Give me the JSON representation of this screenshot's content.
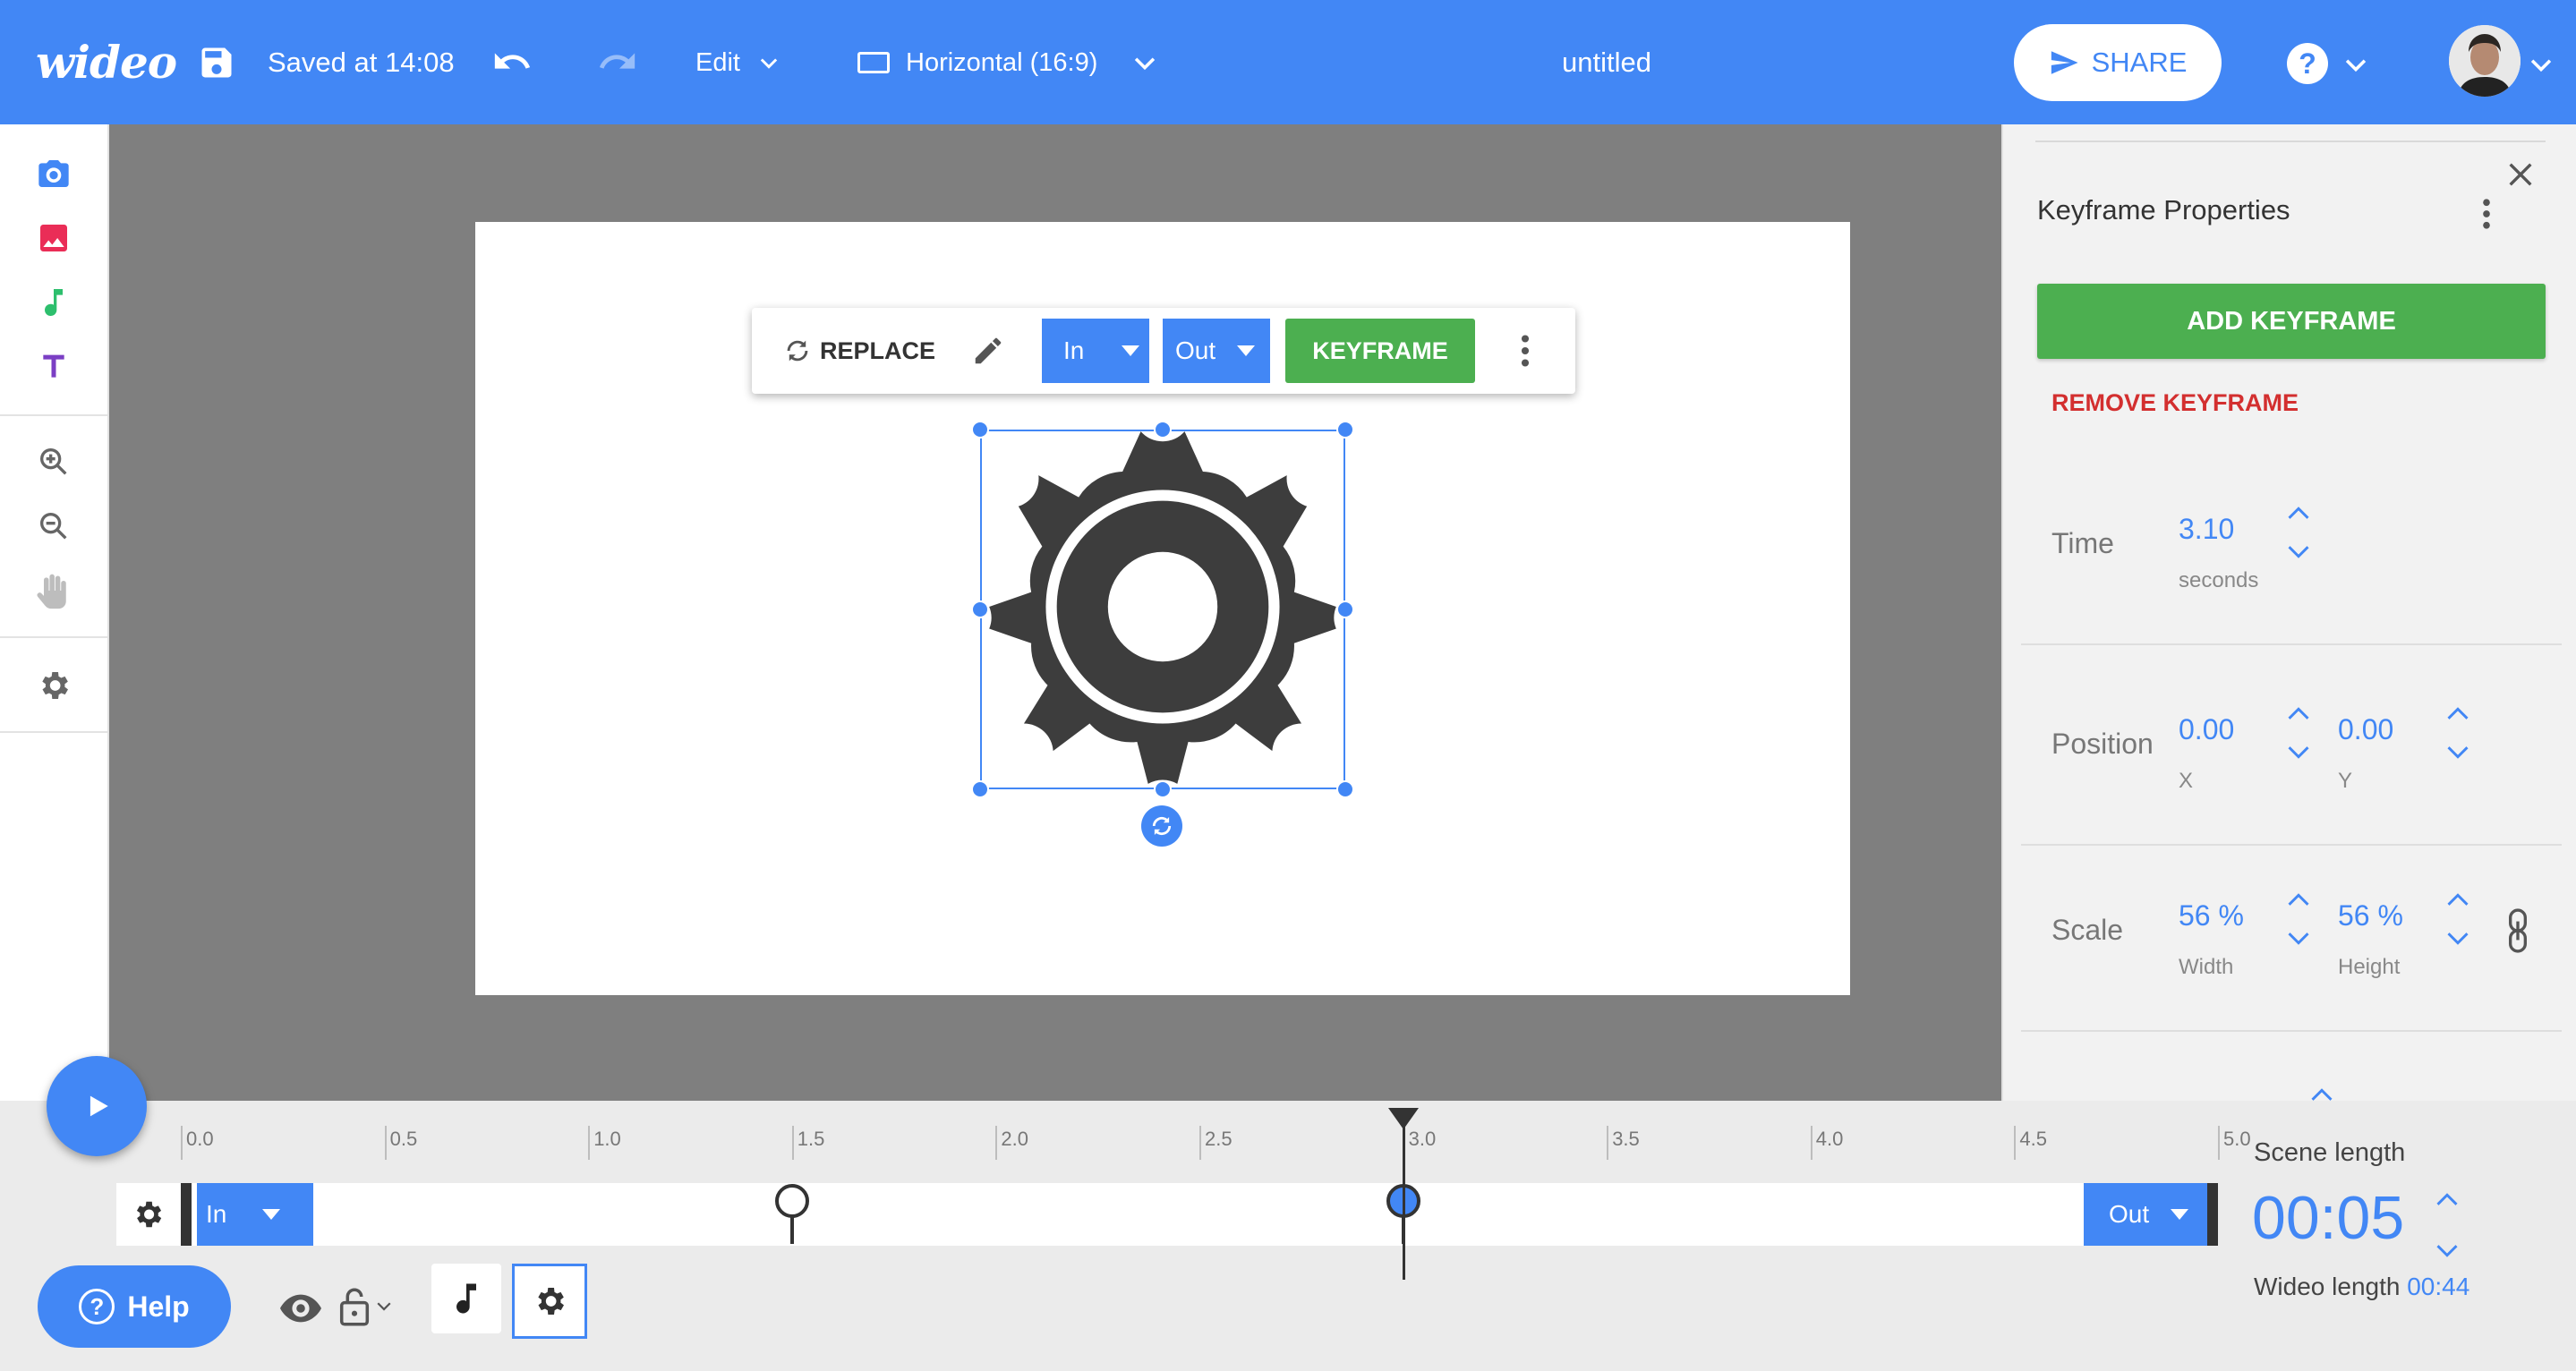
{
  "app": {
    "logo": "wideo",
    "saved_status": "Saved at 14:08",
    "edit_menu": "Edit",
    "format": "Horizontal (16:9)",
    "document_title": "untitled",
    "share_label": "SHARE",
    "help_glyph": "?"
  },
  "context_toolbar": {
    "replace_label": "REPLACE",
    "in_label": "In",
    "out_label": "Out",
    "keyframe_label": "KEYFRAME"
  },
  "right_panel": {
    "title": "Keyframe Properties",
    "add_keyframe": "ADD KEYFRAME",
    "remove_keyframe": "REMOVE KEYFRAME",
    "time": {
      "label": "Time",
      "value": "3.10",
      "unit": "seconds"
    },
    "position": {
      "label": "Position",
      "x_value": "0.00",
      "x_label": "X",
      "y_value": "0.00",
      "y_label": "Y"
    },
    "scale": {
      "label": "Scale",
      "width_value": "56 %",
      "width_label": "Width",
      "height_value": "56 %",
      "height_label": "Height"
    }
  },
  "timeline": {
    "ruler": [
      "0.0",
      "0.5",
      "1.0",
      "1.5",
      "2.0",
      "2.5",
      "3.0",
      "3.5",
      "4.0",
      "4.5",
      "5.0"
    ],
    "in_label": "In",
    "out_label": "Out",
    "keyframes": [
      1.5,
      3.0
    ],
    "playhead_seconds": 3.0,
    "scene_length_label": "Scene length",
    "scene_length_value": "00:05",
    "wideo_length_label": "Wideo length",
    "wideo_length_value": "00:44",
    "help_label": "Help"
  },
  "colors": {
    "brand_blue": "#4287f5",
    "keyframe_green": "#4caf50",
    "remove_red": "#d32f2f"
  },
  "icons": {
    "left_toolbar": [
      "camera-icon",
      "image-icon",
      "music-note-icon",
      "text-icon",
      "zoom-in-icon",
      "zoom-out-icon",
      "hand-icon",
      "settings-gear-icon"
    ]
  }
}
